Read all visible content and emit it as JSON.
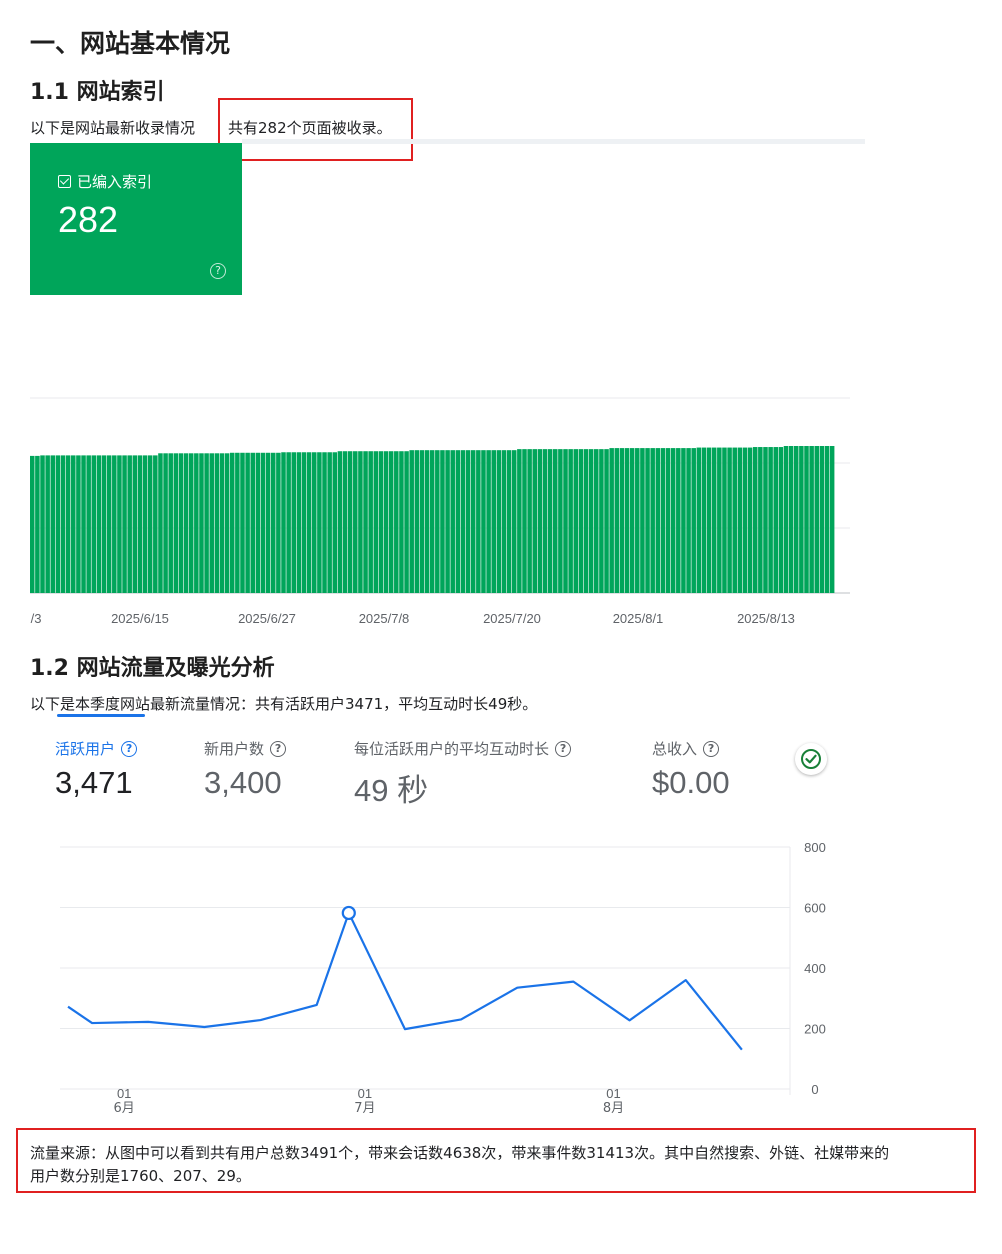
{
  "section1": {
    "title": "一、网站基本情况",
    "sub1_title": "1.1 网站索引",
    "index_intro": "以下是网站最新收录情况",
    "index_highlight": "共有282个页面被收录。",
    "index_card": {
      "label": "已编入索引",
      "value": "282",
      "help_icon": "help-circle-icon",
      "check_icon": "checkbox-icon",
      "color": "#00a55a"
    }
  },
  "index_chart": {
    "chart_data": {
      "type": "bar",
      "color": "#00a55a",
      "x_tick_labels": [
        "/3",
        "2025/6/15",
        "2025/6/27",
        "2025/7/8",
        "2025/7/20",
        "2025/8/1",
        "2025/8/13"
      ],
      "values": [
        263,
        263,
        264,
        264,
        264,
        264,
        264,
        264,
        264,
        264,
        264,
        264,
        264,
        264,
        264,
        264,
        264,
        264,
        264,
        264,
        264,
        264,
        264,
        264,
        264,
        268,
        268,
        268,
        268,
        268,
        268,
        268,
        268,
        268,
        268,
        268,
        268,
        268,
        268,
        269,
        269,
        269,
        269,
        269,
        269,
        269,
        269,
        269,
        269,
        270,
        270,
        270,
        270,
        270,
        270,
        270,
        270,
        270,
        270,
        270,
        272,
        272,
        272,
        272,
        272,
        272,
        272,
        272,
        272,
        272,
        272,
        272,
        272,
        272,
        274,
        274,
        274,
        274,
        274,
        274,
        274,
        274,
        274,
        274,
        274,
        274,
        274,
        274,
        274,
        274,
        274,
        274,
        274,
        274,
        274,
        276,
        276,
        276,
        276,
        276,
        276,
        276,
        276,
        276,
        276,
        276,
        276,
        276,
        276,
        276,
        276,
        276,
        276,
        278,
        278,
        278,
        278,
        278,
        278,
        278,
        278,
        278,
        278,
        278,
        278,
        278,
        278,
        278,
        278,
        278,
        279,
        279,
        279,
        279,
        279,
        279,
        279,
        279,
        279,
        279,
        279,
        280,
        280,
        280,
        280,
        280,
        280,
        282,
        282,
        282,
        282,
        282,
        282,
        282,
        282,
        282,
        282
      ],
      "ylim": [
        0,
        282
      ],
      "grid": true
    }
  },
  "section2": {
    "sub2_title": "1.2 网站流量及曝光分析",
    "traffic_intro": "以下是本季度网站最新流量情况：共有活跃用户3471，平均互动时长49秒。",
    "metrics": [
      {
        "label": "活跃用户",
        "value": "3,471",
        "active": true
      },
      {
        "label": "新用户数",
        "value": "3,400",
        "active": false
      },
      {
        "label": "每位活跃用户的平均互动时长",
        "value": "49 秒",
        "active": false
      },
      {
        "label": "总收入",
        "value": "$0.00",
        "active": false
      }
    ],
    "status_icon": "check-circle-icon",
    "accent_color": "#1a73e8"
  },
  "traffic_chart": {
    "chart_data": {
      "type": "line",
      "x": [
        "2025-05-25",
        "2025-05-28",
        "2025-06-04",
        "2025-06-11",
        "2025-06-18",
        "2025-06-25",
        "2025-06-29",
        "2025-07-06",
        "2025-07-13",
        "2025-07-20",
        "2025-07-27",
        "2025-08-03",
        "2025-08-10",
        "2025-08-17"
      ],
      "values": [
        272,
        218,
        222,
        205,
        228,
        278,
        582,
        198,
        230,
        335,
        355,
        227,
        360,
        130
      ],
      "highlight_index": 6,
      "ylim": [
        0,
        800
      ],
      "y_ticks": [
        "0",
        "200",
        "400",
        "600",
        "800"
      ],
      "x_ticks": [
        {
          "day": "01",
          "month": "6月",
          "date": "2025-06-01"
        },
        {
          "day": "01",
          "month": "7月",
          "date": "2025-07-01"
        },
        {
          "day": "01",
          "month": "8月",
          "date": "2025-08-01"
        }
      ],
      "color": "#1a73e8",
      "grid": true
    }
  },
  "footnote": {
    "line1": "流量来源：从图中可以看到共有用户总数3491个，带来会话数4638次，带来事件数31413次。其中自然搜索、外链、社媒带来的",
    "line2": "用户数分别是1760、207、29。"
  }
}
